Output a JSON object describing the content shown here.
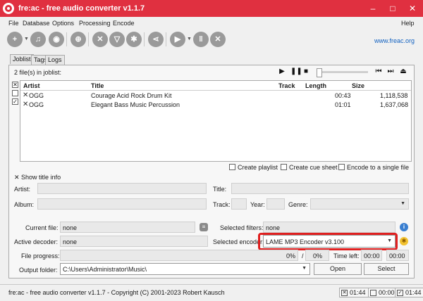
{
  "window": {
    "title": "fre:ac - free audio converter v1.1.7",
    "min": "–",
    "max": "□",
    "close": "✕"
  },
  "menu": {
    "file": "File",
    "database": "Database",
    "options": "Options",
    "processing": "Processing",
    "encode": "Encode",
    "help": "Help"
  },
  "toolbar": {
    "icons": [
      "add-files-icon",
      "add-folder-icon",
      "cd-icon",
      "remove-icon",
      "clear-icon",
      "cddb-icon",
      "filter-icon",
      "config-icon",
      "share-icon",
      "play-icon",
      "pause-icon",
      "stop-icon"
    ],
    "link": "www.freac.org"
  },
  "tabs": [
    "Joblist",
    "Tags",
    "Logs"
  ],
  "joblist": {
    "count": "2 file(s) in joblist:",
    "columns": [
      "Artist",
      "Title",
      "Track",
      "Length",
      "Size"
    ],
    "rows": [
      {
        "artist": "OGG",
        "title": "Courage Acid Rock Drum Kit",
        "track": "",
        "length": "00:43",
        "size": "1,118,538",
        "checked": false
      },
      {
        "artist": "OGG",
        "title": "Elegant Bass Music Percussion",
        "track": "",
        "length": "01:01",
        "size": "1,637,068",
        "checked": true
      }
    ]
  },
  "options": {
    "playlist": "Create playlist",
    "cuesheet": "Create cue sheet",
    "single": "Encode to a single file"
  },
  "titleinfo": {
    "show": "Show title info",
    "artist": "Artist:",
    "title": "Title:",
    "album": "Album:",
    "track": "Track:",
    "year": "Year:",
    "genre": "Genre:"
  },
  "status": {
    "current_file_label": "Current file:",
    "current_file": "none",
    "filters_label": "Selected filters:",
    "filters": "none",
    "decoder_label": "Active decoder:",
    "decoder": "none",
    "encoder_label": "Selected encoder:",
    "encoder": "LAME MP3 Encoder v3.100",
    "progress_label": "File progress:",
    "progress_pct": "0%",
    "sep": "/",
    "total_pct": "0%",
    "time_left_label": "Time left:",
    "time_left": "00:00",
    "time_total": "00:00",
    "output_label": "Output folder:",
    "output": "C:\\Users\\Administrator\\Music\\",
    "open": "Open",
    "select": "Select"
  },
  "statusbar": {
    "text": "fre:ac - free audio converter v1.1.7 - Copyright (C) 2001-2023 Robert Kausch",
    "t1": "01:44",
    "t2": "00:00",
    "t3": "01:44"
  },
  "colors": {
    "titlebar": "#e03040",
    "highlight": "#e02020",
    "link": "#1060c0"
  }
}
